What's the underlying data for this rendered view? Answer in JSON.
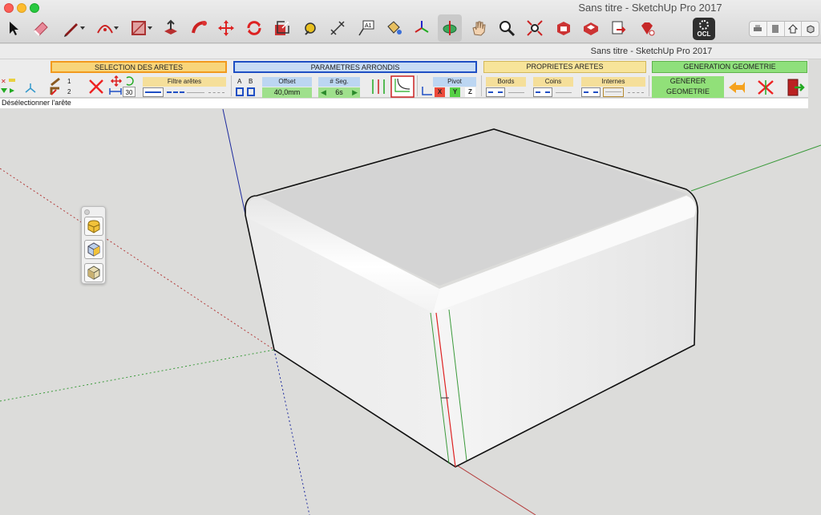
{
  "window": {
    "title": "Sans titre - SketchUp Pro 2017",
    "palette_title": "Sans titre - SketchUp Pro 2017"
  },
  "toolbar": {
    "tools": [
      "select-icon",
      "eraser-icon",
      "pencil-line-icon",
      "arc-icon",
      "rectangle-icon",
      "push-pull-icon",
      "follow-me-icon",
      "move-icon",
      "rotate-icon",
      "scale-icon",
      "tape-measure-icon",
      "dimension-icon",
      "text-label-icon",
      "paint-bucket-icon",
      "axes-icon",
      "section-plane-icon",
      "pan-icon",
      "zoom-icon",
      "zoom-extents-icon",
      "3d-warehouse-icon",
      "extension-warehouse-icon",
      "share-model-icon",
      "ruby-icon"
    ],
    "ocl_label": "OCL",
    "view_buttons": [
      "print-icon",
      "book-icon",
      "home-icon",
      "iso-view-icon"
    ]
  },
  "plugin": {
    "sections": {
      "selection": "SELECTION DES ARETES",
      "parameters": "PARAMETRES ARRONDIS",
      "properties": "PROPRIETES ARETES",
      "generation": "GENERATION GEOMETRIE"
    },
    "selection": {
      "count_1": "1",
      "count_2": "2",
      "angle_value": "30",
      "filter_label": "Filtre arêtes"
    },
    "parameters": {
      "a_label": "A",
      "b_label": "B",
      "offset_label": "Offset",
      "offset_value": "40,0mm",
      "segments_label": "# Seg.",
      "segments_value": "6s",
      "pivot_label": "Pivot",
      "pivot_x": "X",
      "pivot_y": "Y",
      "pivot_z": "Z"
    },
    "properties": {
      "bords_label": "Bords",
      "coins_label": "Coins",
      "internes_label": "Internes"
    },
    "generation": {
      "generate_line1": "GENERER",
      "generate_line2": "GEOMETRIE"
    },
    "colors": {
      "selection_border": "#f29a1e",
      "parameters_border": "#1f4fc4",
      "generate_green": "#91e079"
    }
  },
  "status": {
    "hint": "Désélectionner l'arête"
  },
  "mini_palette": {
    "buttons": [
      "round-corner-icon",
      "sharp-corner-icon",
      "bevel-corner-icon"
    ]
  }
}
